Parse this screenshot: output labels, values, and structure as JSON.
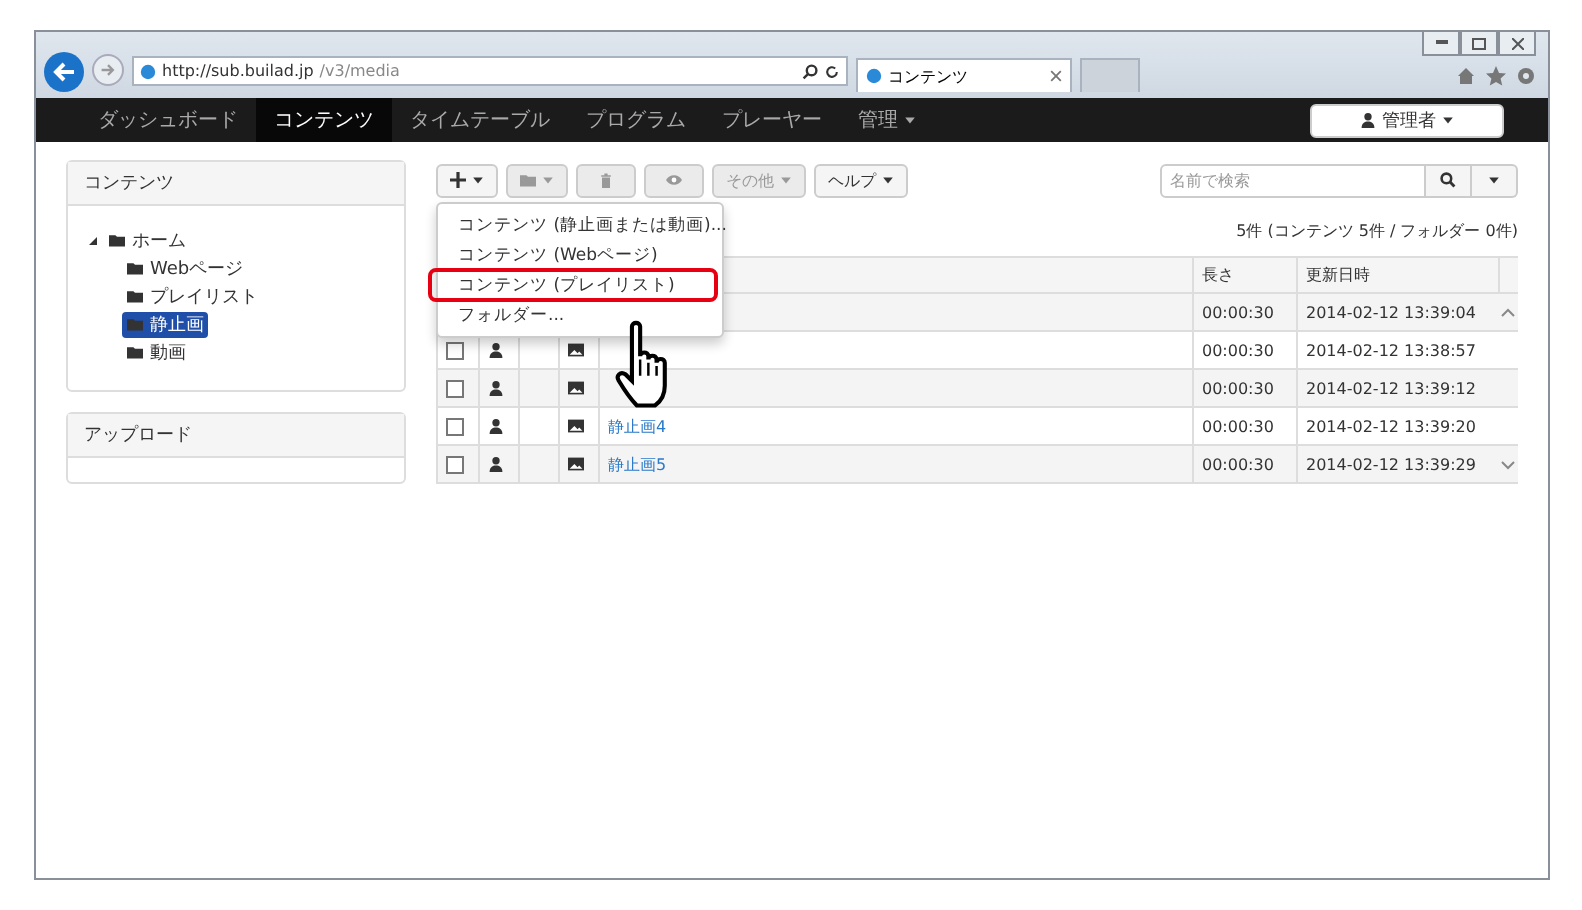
{
  "browser": {
    "url_host": "http://sub.builad.jp",
    "url_path": "/v3/media",
    "tab_title": "コンテンツ"
  },
  "nav": {
    "items": [
      {
        "label": "ダッシュボード",
        "selected": false,
        "dropdown": false
      },
      {
        "label": "コンテンツ",
        "selected": true,
        "dropdown": false
      },
      {
        "label": "タイムテーブル",
        "selected": false,
        "dropdown": false
      },
      {
        "label": "プログラム",
        "selected": false,
        "dropdown": false
      },
      {
        "label": "プレーヤー",
        "selected": false,
        "dropdown": false
      },
      {
        "label": "管理",
        "selected": false,
        "dropdown": true
      }
    ],
    "user": "管理者"
  },
  "sidebar": {
    "panels": [
      {
        "title": "コンテンツ",
        "tree": [
          {
            "label": "ホーム",
            "selected": false,
            "expanded": true,
            "children": [
              {
                "label": "Webページ",
                "selected": false
              },
              {
                "label": "プレイリスト",
                "selected": false
              },
              {
                "label": "静止画",
                "selected": true
              },
              {
                "label": "動画",
                "selected": false
              }
            ]
          }
        ]
      },
      {
        "title": "アップロード"
      }
    ]
  },
  "toolbar": {
    "buttons": [
      {
        "kind": "add",
        "disabled": false,
        "dropdown": true
      },
      {
        "kind": "folder",
        "disabled": true,
        "dropdown": true
      },
      {
        "kind": "delete",
        "disabled": true,
        "dropdown": false
      },
      {
        "kind": "preview",
        "disabled": true,
        "dropdown": false
      },
      {
        "kind": "text",
        "label": "その他",
        "disabled": true,
        "dropdown": true
      },
      {
        "kind": "text",
        "label": "ヘルプ",
        "disabled": false,
        "dropdown": true
      }
    ]
  },
  "search": {
    "placeholder": "名前で検索"
  },
  "summary": "5件 (コンテンツ 5件 / フォルダー 0件)",
  "menu": {
    "items": [
      {
        "label": "コンテンツ (静止画または動画)...",
        "highlighted": false
      },
      {
        "label": "コンテンツ (Webページ)",
        "highlighted": false
      },
      {
        "label": "コンテンツ (プレイリスト)",
        "highlighted": true
      },
      {
        "label": "フォルダー...",
        "highlighted": false
      }
    ]
  },
  "table": {
    "columns": [
      "長さ",
      "更新日時"
    ],
    "rows": [
      {
        "length": "00:00:30",
        "updated": "2014-02-12 13:39:04"
      },
      {
        "checked": false,
        "length": "00:00:30",
        "updated": "2014-02-12 13:38:57"
      },
      {
        "checked": false,
        "length": "00:00:30",
        "updated": "2014-02-12 13:39:12"
      },
      {
        "checked": false,
        "name": "静止画4",
        "length": "00:00:30",
        "updated": "2014-02-12 13:39:20"
      },
      {
        "checked": false,
        "name": "静止画5",
        "length": "00:00:30",
        "updated": "2014-02-12 13:39:29"
      }
    ]
  }
}
